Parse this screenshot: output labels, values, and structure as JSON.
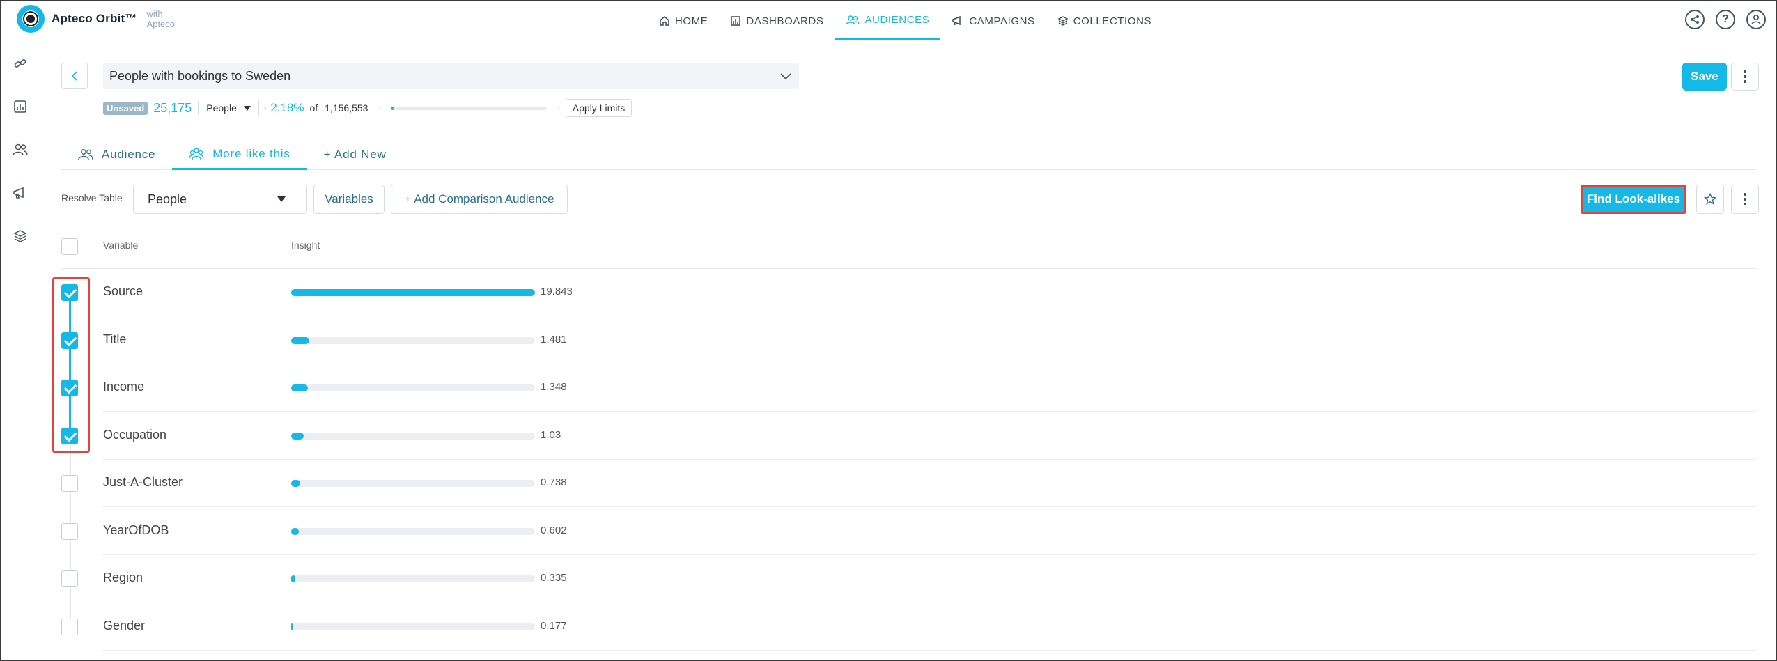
{
  "app": {
    "name": "Apteco Orbit™",
    "with_label": "with",
    "with_brand": "Apteco"
  },
  "nav": [
    {
      "label": "HOME",
      "icon": "home-icon",
      "active": false
    },
    {
      "label": "DASHBOARDS",
      "icon": "dashboard-icon",
      "active": false
    },
    {
      "label": "AUDIENCES",
      "icon": "audiences-icon",
      "active": true
    },
    {
      "label": "CAMPAIGNS",
      "icon": "campaigns-icon",
      "active": false
    },
    {
      "label": "COLLECTIONS",
      "icon": "collections-icon",
      "active": false
    }
  ],
  "top_icons": [
    "share-icon",
    "help-icon",
    "user-icon"
  ],
  "rail_icons": [
    "link-icon",
    "chart-icon",
    "people-icon",
    "megaphone-icon",
    "layers-icon"
  ],
  "audience": {
    "title": "People with bookings to Sweden",
    "status_badge": "Unsaved",
    "count": "25,175",
    "resolve_unit": "People",
    "percent": "· 2.18%",
    "of_label": "of",
    "total": "1,156,553",
    "separator": "·",
    "progress_fraction": 0.0218,
    "apply_limits_label": "Apply Limits",
    "save_label": "Save"
  },
  "tabs": [
    {
      "label": "Audience",
      "active": false
    },
    {
      "label": "More like this",
      "active": true
    },
    {
      "label": "+ Add New",
      "active": false
    }
  ],
  "toolbar": {
    "resolve_label": "Resolve Table",
    "resolve_value": "People",
    "variables_label": "Variables",
    "add_comparison_label": "+ Add Comparison Audience",
    "find_lookalikes_label": "Find Look-alikes"
  },
  "table": {
    "col_variable": "Variable",
    "col_insight": "Insight",
    "max_value": 19.843,
    "rows": [
      {
        "variable": "Source",
        "insight": 19.843,
        "insight_text": "19.843",
        "checked": true
      },
      {
        "variable": "Title",
        "insight": 1.481,
        "insight_text": "1.481",
        "checked": true
      },
      {
        "variable": "Income",
        "insight": 1.348,
        "insight_text": "1.348",
        "checked": true
      },
      {
        "variable": "Occupation",
        "insight": 1.03,
        "insight_text": "1.03",
        "checked": true
      },
      {
        "variable": "Just-A-Cluster",
        "insight": 0.738,
        "insight_text": "0.738",
        "checked": false
      },
      {
        "variable": "YearOfDOB",
        "insight": 0.602,
        "insight_text": "0.602",
        "checked": false
      },
      {
        "variable": "Region",
        "insight": 0.335,
        "insight_text": "0.335",
        "checked": false
      },
      {
        "variable": "Gender",
        "insight": 0.177,
        "insight_text": "0.177",
        "checked": false
      }
    ]
  },
  "colors": {
    "accent": "#14b9e6",
    "highlight": "#e0443c",
    "badge": "#9bb8c8"
  }
}
